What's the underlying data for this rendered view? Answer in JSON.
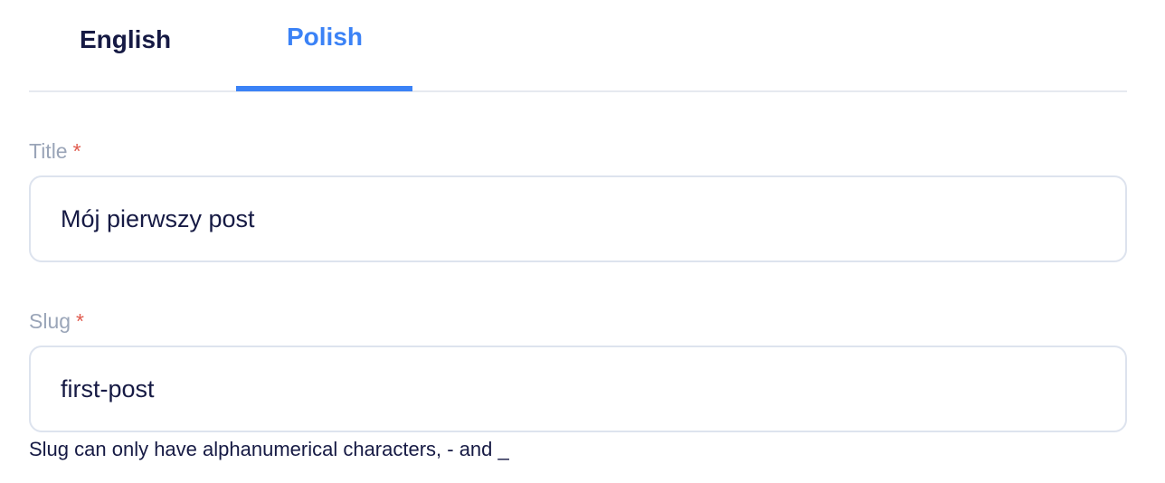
{
  "tabs": [
    {
      "label": "English",
      "active": false
    },
    {
      "label": "Polish",
      "active": true
    }
  ],
  "form": {
    "title": {
      "label": "Title",
      "required_marker": "*",
      "value": "Mój pierwszy post"
    },
    "slug": {
      "label": "Slug",
      "required_marker": "*",
      "value": "first-post",
      "hint": "Slug can only have alphanumerical characters, - and _"
    }
  },
  "colors": {
    "accent": "#3b82f6",
    "text": "#161a44",
    "muted_label": "#9aa5b8",
    "required": "#e05a4d",
    "border": "#dde3ee"
  }
}
